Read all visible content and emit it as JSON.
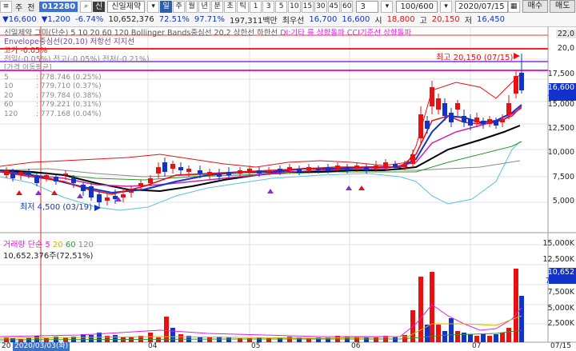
{
  "toolbar": {
    "left_labels": [
      "주",
      "전"
    ],
    "stock_code": "012280",
    "credit_tag": "신",
    "stock_name": "신일제약",
    "period_tabs": [
      "일",
      "주",
      "월",
      "년",
      "분",
      "초",
      "틱"
    ],
    "interval_buttons": [
      "1",
      "3",
      "5",
      "10",
      "15",
      "30",
      "45",
      "60"
    ],
    "tick_value": "3",
    "count": "100/600",
    "date": "2020/07/15",
    "buy": "매수",
    "sell": "매도"
  },
  "quote": {
    "price": "16,600",
    "change": "1,200",
    "rate": "-6.74%",
    "volume": "10,652,376",
    "turnover_pct": "72.51%",
    "strength": "97.71%",
    "amount": "197,311백만",
    "best_ask_label": "최우선",
    "best_ask": "16,700",
    "best_bid": "16,600",
    "open_label": "시",
    "open": "18,800",
    "high_label": "고",
    "high": "20,150",
    "low_label": "저",
    "low": "16,450"
  },
  "legend": {
    "line1": "신일제약 그미(단순) 5 10 20 60 120  Bollinger Bands중심선 20,2  상한선  하한선",
    "line1b": "DI:기타 를 상향돌파   CCI기준선 상향돌파",
    "line2": "Envelope중심선(20,10) 저항선 지지선",
    "line3": "고가 -0.05%",
    "line4": "전일(-0.05%) 전고(-0.05%) 전저(-0.21%)"
  },
  "indicator_panel": {
    "title": "[가격 이동평균]",
    "rows": [
      {
        "period": "5",
        "value": "778.746 (0.25%)"
      },
      {
        "period": "10",
        "value": "779.710 (0.37%)"
      },
      {
        "period": "20",
        "value": "779.784 (0.38%)"
      },
      {
        "period": "60",
        "value": "779.221 (0.31%)"
      },
      {
        "period": "120",
        "value": "777.168 (0.04%)"
      }
    ]
  },
  "annotations": {
    "high": "최고 20,150 (07/15)",
    "low": "최저 4,500 (03/19)"
  },
  "axis": {
    "right_labels": [
      "22,0",
      "20,0",
      "17,500",
      "15,000",
      "12,500",
      "10,000",
      "7,500",
      "5,000"
    ],
    "current_price": "16,600",
    "current_change": "-6.74%",
    "vol_labels": [
      "15,000K",
      "12,500K",
      "10,000K",
      "7,500K",
      "5,000K",
      "2,500K"
    ],
    "vol_current": "10,652",
    "vol_pct": "72.51%",
    "x_labels": [
      "20",
      "2020/03/03(화)",
      "04",
      "05",
      "06",
      "07",
      "07/15"
    ]
  },
  "volume_legend": {
    "title": "거래량",
    "ma_label": "단순",
    "periods": [
      "5",
      "20",
      "60",
      "120"
    ],
    "value": "10,652,376주(72,51%)"
  },
  "colors": {
    "up": "#e81010",
    "down": "#1133cc",
    "ma5": "#e81010",
    "ma10": "#1133cc",
    "ma20": "#d020b0",
    "ma60": "#000000",
    "ma120": "#2a9a2a"
  }
}
